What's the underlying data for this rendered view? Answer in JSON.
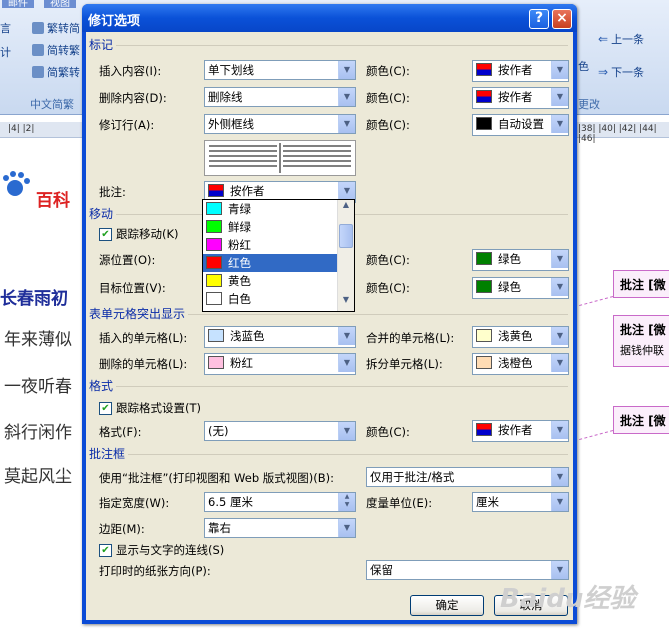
{
  "ribbon": {
    "tabs": [
      "邮件",
      "视图"
    ],
    "left_labels": [
      "言",
      "计"
    ],
    "convert_buttons": [
      "繁转简",
      "简转繁",
      "简繁转"
    ],
    "group_label": "中文简繁",
    "right_letter": "色",
    "prev_button": "上一条",
    "next_button": "下一条",
    "change_group": "更改"
  },
  "ruler": {
    "left": "|4| |2|",
    "right": "|38| |40| |42| |44| |46|"
  },
  "document": {
    "logo_text": "百科",
    "line1": "长春雨初",
    "line2": "年来薄似",
    "line3": "一夜听春",
    "line4": "斜行闲作",
    "line5": "莫起风尘",
    "balloon1": "批注 [微",
    "balloon2": "批注 [微",
    "balloon2_sub": "据钱仲联",
    "balloon3": "批注 [微"
  },
  "watermark": "Baidu经验",
  "dialog": {
    "title": "修订选项",
    "help_button": "?",
    "close_button": "×",
    "markup": {
      "section": "标记",
      "insert_label": "插入内容(I):",
      "insert_value": "单下划线",
      "delete_label": "删除内容(D):",
      "delete_value": "删除线",
      "changed_lines_label": "修订行(A):",
      "changed_lines_value": "外侧框线",
      "color_label": "颜色(C):",
      "insert_color": "按作者",
      "delete_color": "按作者",
      "changed_lines_color": "自动设置",
      "comments_label": "批注:",
      "comments_value": "按作者"
    },
    "color_list": [
      "青绿",
      "鲜绿",
      "粉红",
      "红色",
      "黄色",
      "白色"
    ],
    "color_swatches": [
      "#00ffff",
      "#00ff00",
      "#ff00ff",
      "#ff0000",
      "#ffff00",
      "#ffffff"
    ],
    "moves": {
      "section": "移动",
      "track_label": "跟踪移动(K)",
      "from_label": "源位置(O):",
      "to_label": "目标位置(V):",
      "color_label": "颜色(C):",
      "from_color": "绿色",
      "to_color": "绿色"
    },
    "table": {
      "section": "表单元格突出显示",
      "inserted_label": "插入的单元格(L):",
      "inserted_value": "浅蓝色",
      "deleted_label": "删除的单元格(L):",
      "deleted_value": "粉红",
      "merged_label": "合并的单元格(L):",
      "merged_value": "浅黄色",
      "split_label": "拆分单元格(L):",
      "split_value": "浅橙色"
    },
    "formatting": {
      "section": "格式",
      "track_label": "跟踪格式设置(T)",
      "format_label": "格式(F):",
      "format_value": "(无)",
      "color_label": "颜色(C):",
      "color_value": "按作者"
    },
    "balloons": {
      "section": "批注框",
      "use_label": "使用“批注框”(打印视图和 Web 版式视图)(B):",
      "use_value": "仅用于批注/格式",
      "width_label": "指定宽度(W):",
      "width_value": "6.5 厘米",
      "unit_label": "度量单位(E):",
      "unit_value": "厘米",
      "margin_label": "边距(M):",
      "margin_value": "靠右",
      "lines_label": "显示与文字的连线(S)",
      "paper_label": "打印时的纸张方向(P):",
      "paper_value": "保留"
    },
    "ok_button": "确定",
    "cancel_button": "取消"
  },
  "colors": {
    "byauthor_top": "#ff0000",
    "byauthor_bottom": "#0000cc",
    "auto": "#000000",
    "green": "#008000",
    "light_blue": "#c6e2ff",
    "pink": "#ffc0e0",
    "light_yellow": "#ffffcc",
    "light_orange": "#ffdcb4",
    "section_blue": "#0a2ca8",
    "selection": "#316ac5"
  }
}
